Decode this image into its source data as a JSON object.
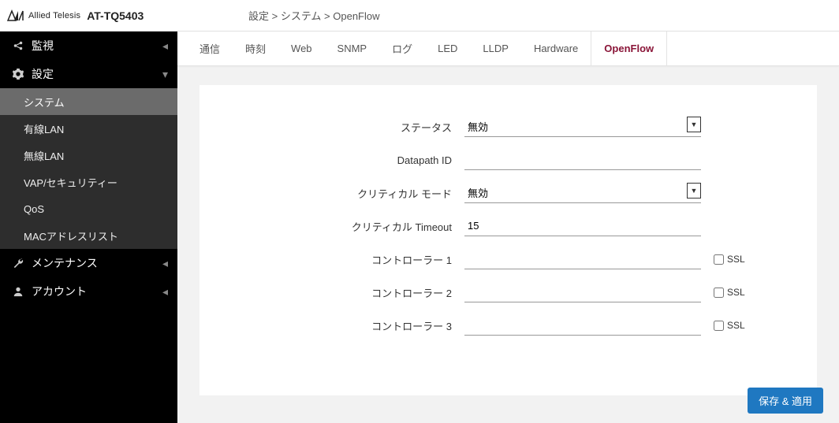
{
  "header": {
    "brand_text": "Allied Telesis",
    "device_name": "AT-TQ5403",
    "breadcrumb": "設定 > システム > OpenFlow"
  },
  "sidebar": {
    "groups": [
      {
        "icon": "share",
        "label": "監視",
        "expanded": false
      },
      {
        "icon": "gear",
        "label": "設定",
        "expanded": true
      },
      {
        "icon": "wrench",
        "label": "メンテナンス",
        "expanded": false
      },
      {
        "icon": "user",
        "label": "アカウント",
        "expanded": false
      }
    ],
    "settings_children": [
      {
        "label": "システム",
        "active": true
      },
      {
        "label": "有線LAN",
        "active": false
      },
      {
        "label": "無線LAN",
        "active": false
      },
      {
        "label": "VAP/セキュリティー",
        "active": false
      },
      {
        "label": "QoS",
        "active": false
      },
      {
        "label": "MACアドレスリスト",
        "active": false
      }
    ]
  },
  "tabs": [
    {
      "label": "通信",
      "active": false
    },
    {
      "label": "時刻",
      "active": false
    },
    {
      "label": "Web",
      "active": false
    },
    {
      "label": "SNMP",
      "active": false
    },
    {
      "label": "ログ",
      "active": false
    },
    {
      "label": "LED",
      "active": false
    },
    {
      "label": "LLDP",
      "active": false
    },
    {
      "label": "Hardware",
      "active": false
    },
    {
      "label": "OpenFlow",
      "active": true
    }
  ],
  "form": {
    "status_label": "ステータス",
    "status_value": "無効",
    "datapath_label": "Datapath ID",
    "datapath_value": "",
    "critical_mode_label": "クリティカル モード",
    "critical_mode_value": "無効",
    "critical_timeout_label": "クリティカル Timeout",
    "critical_timeout_value": "15",
    "controller1_label": "コントローラー 1",
    "controller1_value": "",
    "controller2_label": "コントローラー 2",
    "controller2_value": "",
    "controller3_label": "コントローラー 3",
    "controller3_value": "",
    "ssl_label": "SSL"
  },
  "actions": {
    "save_apply": "保存 & 適用"
  }
}
